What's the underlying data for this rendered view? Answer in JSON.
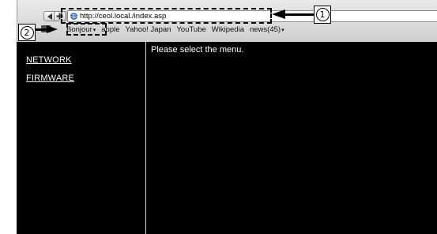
{
  "browser": {
    "address_bar": {
      "url": "http://ceol.local./index.asp"
    },
    "bookmarks": [
      {
        "label": "Bonjour",
        "has_menu": true
      },
      {
        "label": "apple",
        "has_menu": false
      },
      {
        "label": "Yahoo! Japan",
        "has_menu": false
      },
      {
        "label": "YouTube",
        "has_menu": false
      },
      {
        "label": "Wikipedia",
        "has_menu": false
      },
      {
        "label": "news(45)",
        "has_menu": true
      }
    ],
    "menu_indicator": "▾"
  },
  "page": {
    "menu": [
      {
        "label": "NETWORK"
      },
      {
        "label": "FIRMWARE"
      }
    ],
    "message": "Please select the menu."
  },
  "callouts": [
    {
      "number": "1",
      "target": "address bar"
    },
    {
      "number": "2",
      "target": "Bonjour bookmark"
    }
  ],
  "colors": {
    "page_background": "#000000",
    "page_text": "#ffffff",
    "chrome_background": "#d9d9d9",
    "callout": "#000000"
  }
}
